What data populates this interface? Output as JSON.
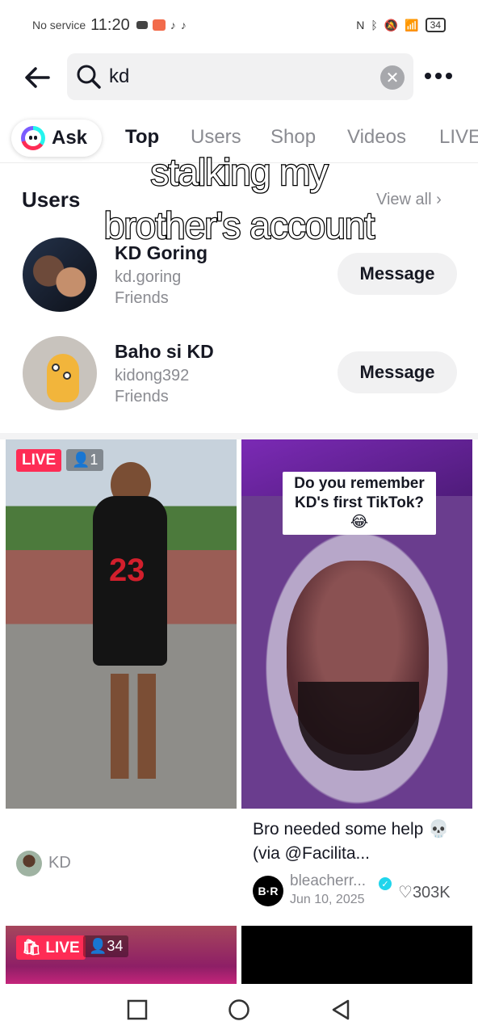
{
  "status_bar": {
    "carrier": "No service",
    "time": "11:20",
    "battery": "34"
  },
  "search": {
    "query": "kd",
    "placeholder": "Search"
  },
  "tabs": {
    "ask": "Ask",
    "items": [
      "Top",
      "Users",
      "Shop",
      "Videos",
      "LIVE"
    ]
  },
  "overlay_caption": {
    "line1": "stalking my",
    "line2": "brother's account"
  },
  "users": {
    "title": "Users",
    "view_all": "View all",
    "list": [
      {
        "name": "KD Goring",
        "handle": "kd.goring",
        "relation": "Friends",
        "action": "Message"
      },
      {
        "name": "Baho si KD",
        "handle": "kidong392",
        "relation": "Friends",
        "action": "Message"
      }
    ]
  },
  "videos": [
    {
      "live_label": "LIVE",
      "viewers": "1",
      "author": "KD"
    },
    {
      "overlay_text_1": "Do you remember",
      "overlay_text_2": "KD's first TikTok? 😂",
      "description": "Bro needed some help 💀 (via @Facilita...",
      "author": "bleacherr...",
      "author_logo": "B·R",
      "date": "Jun 10, 2025",
      "likes": "303K"
    },
    {
      "live_label": "LIVE",
      "viewers": "34"
    }
  ],
  "icons": {
    "back": "arrow-left-icon",
    "search": "search-icon",
    "clear": "close-circle-icon",
    "more": "more-dots-icon",
    "heart": "heart-icon"
  },
  "colors": {
    "accent": "#fe2c55",
    "text": "#161823",
    "muted": "#8a8b91",
    "surface": "#f1f1f2"
  }
}
